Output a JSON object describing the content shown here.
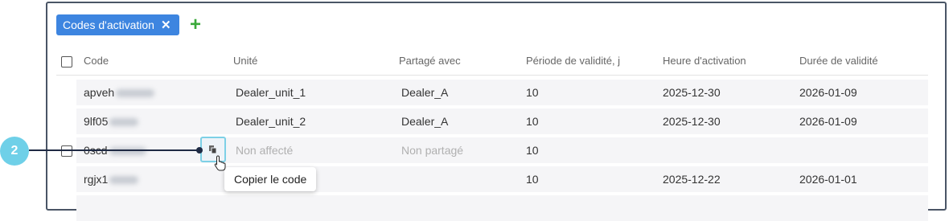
{
  "filter": {
    "chip_label": "Codes d'activation",
    "chip_remove": "✕",
    "add_label": "+"
  },
  "table": {
    "headers": [
      "Code",
      "Unité",
      "Partagé avec",
      "Période de validité, j",
      "Heure d'activation",
      "Durée de validité"
    ],
    "rows": [
      {
        "code": "apveh",
        "unit": "Dealer_unit_1",
        "shared": "Dealer_A",
        "period": "10",
        "activation": "2025-12-30",
        "validity": "2026-01-09"
      },
      {
        "code": "9lf05",
        "unit": "Dealer_unit_2",
        "shared": "Dealer_A",
        "period": "10",
        "activation": "2025-12-30",
        "validity": "2026-01-09"
      },
      {
        "code": "0scd",
        "unit": "Non affecté",
        "shared": "Non partagé",
        "period": "10",
        "activation": "",
        "validity": ""
      },
      {
        "code": "rgjx1",
        "unit": "",
        "shared": "",
        "period": "10",
        "activation": "2025-12-22",
        "validity": "2026-01-01"
      }
    ]
  },
  "tooltip": {
    "text": "Copier le code"
  },
  "annotation": {
    "badge": "2"
  },
  "colors": {
    "chip": "#3d85e0",
    "plus": "#3aa93a",
    "badge": "#6fd0e8",
    "callout": "#1f2a44"
  }
}
